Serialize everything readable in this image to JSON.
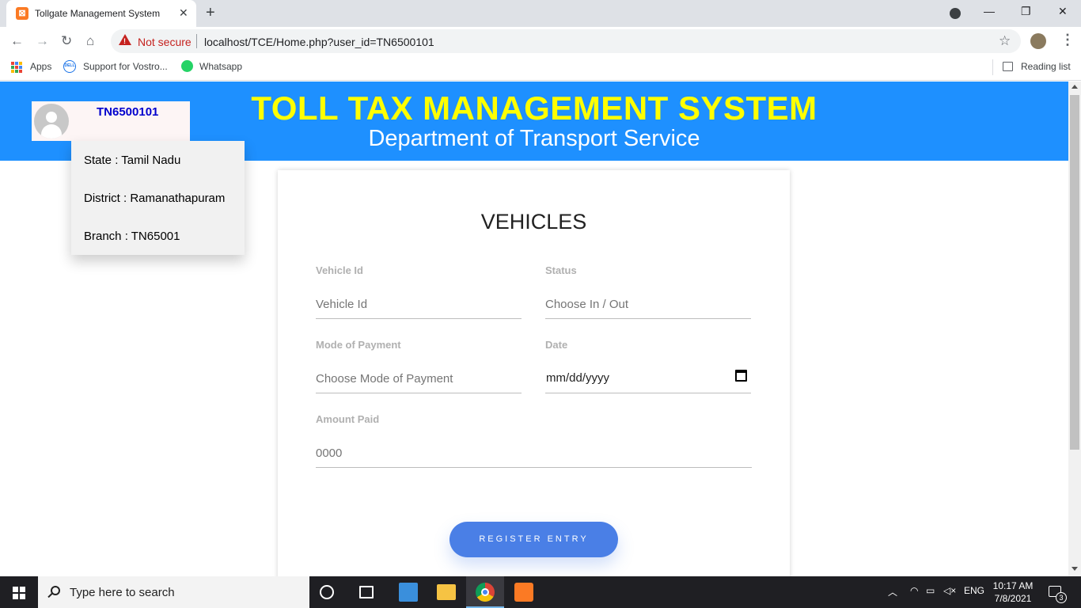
{
  "browser": {
    "tab_title": "Tollgate Management System",
    "tab_close": "✕",
    "new_tab": "+",
    "minimize": "—",
    "restore": "❐",
    "close": "✕",
    "not_secure_label": "Not secure",
    "url": "localhost/TCE/Home.php?user_id=TN6500101",
    "bookmarks": {
      "apps": "Apps",
      "support": "Support for Vostro...",
      "whatsapp": "Whatsapp",
      "reading_list": "Reading list"
    },
    "icons": {
      "back": "back-arrow-icon",
      "forward": "forward-arrow-icon",
      "reload": "reload-icon",
      "home": "home-icon",
      "bookmark": "star-icon",
      "menu": "more-vert-icon"
    }
  },
  "header": {
    "title": "TOLL TAX MANAGEMENT SYSTEM",
    "subtitle": "Department of Transport Service",
    "title_color": "#ffff00",
    "bg_color": "#1e90ff"
  },
  "user": {
    "id": "TN6500101",
    "state": "State : Tamil Nadu",
    "district": "District : Ramanathapuram",
    "branch": "Branch : TN65001"
  },
  "form": {
    "title": "VEHICLES",
    "vehicle_id": {
      "label": "Vehicle Id",
      "placeholder": "Vehicle Id"
    },
    "status": {
      "label": "Status",
      "placeholder": "Choose In / Out"
    },
    "payment_mode": {
      "label": "Mode of Payment",
      "placeholder": "Choose Mode of Payment"
    },
    "date": {
      "label": "Date",
      "placeholder": "mm/dd/yyyy"
    },
    "amount_paid": {
      "label": "Amount Paid",
      "placeholder": "0000"
    },
    "submit_label": "REGISTER ENTRY",
    "button_color": "#4a7fe6"
  },
  "taskbar": {
    "search_placeholder": "Type here to search",
    "language": "ENG",
    "time": "10:17 AM",
    "date": "7/8/2021",
    "notifications": "3",
    "tray_chevron": "︿"
  }
}
